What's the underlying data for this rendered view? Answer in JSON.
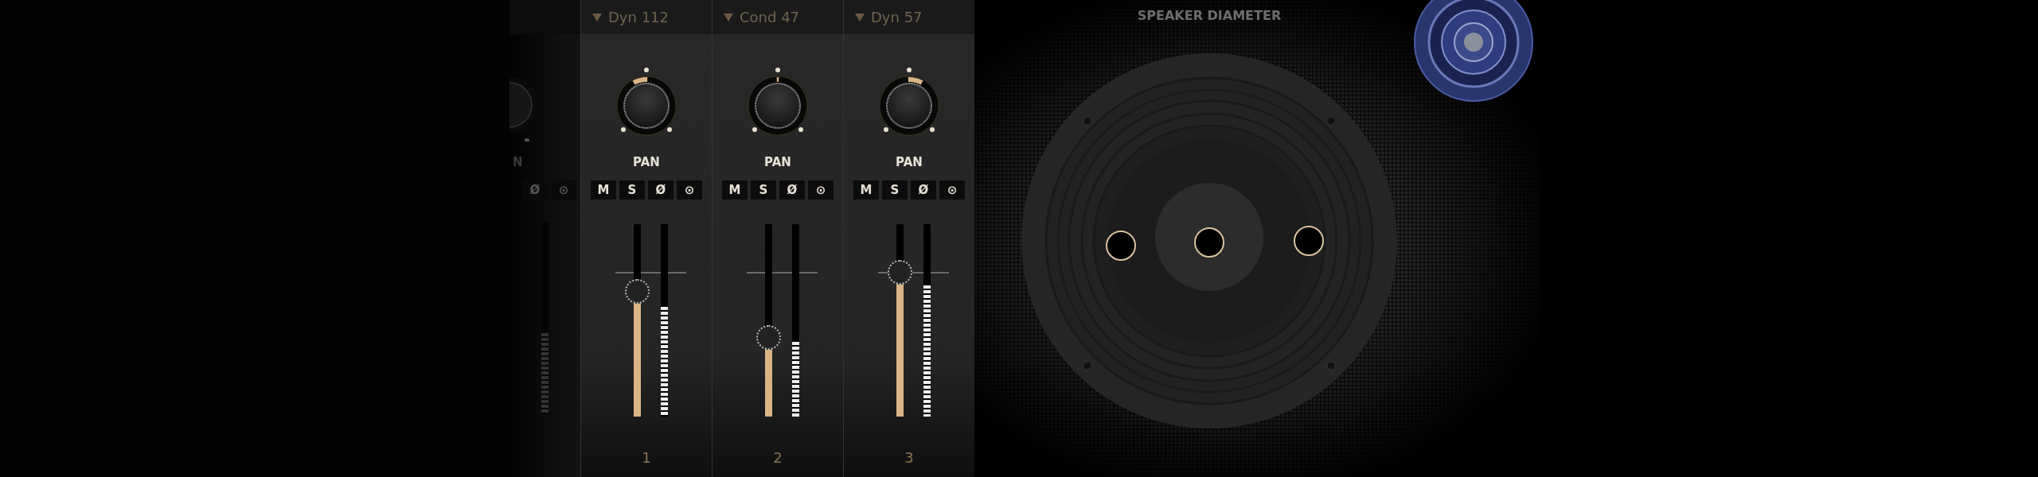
{
  "cut_channel": {
    "pan_label": "N",
    "buttons": [
      "Ø",
      "⊙"
    ],
    "meter": {
      "level": 0.42
    }
  },
  "channels": [
    {
      "name": "Dyn 112",
      "pan": {
        "level": 0.4
      },
      "pan_label": "PAN",
      "buttons": [
        "M",
        "S",
        "Ø",
        "⊙"
      ],
      "fader": {
        "level": 0.65
      },
      "meter": {
        "level": 0.57
      },
      "number": "1"
    },
    {
      "name": "Cond 47",
      "pan": {
        "level": 0.5
      },
      "pan_label": "PAN",
      "buttons": [
        "M",
        "S",
        "Ø",
        "⊙"
      ],
      "fader": {
        "level": 0.41
      },
      "meter": {
        "level": 0.39
      },
      "number": "2"
    },
    {
      "name": "Dyn 57",
      "pan": {
        "level": 0.6
      },
      "pan_label": "PAN",
      "buttons": [
        "M",
        "S",
        "Ø",
        "⊙"
      ],
      "fader": {
        "level": 0.75
      },
      "meter": {
        "level": 0.68
      },
      "number": "3"
    }
  ],
  "speaker": {
    "title": "SPEAKER DIAMETER"
  }
}
